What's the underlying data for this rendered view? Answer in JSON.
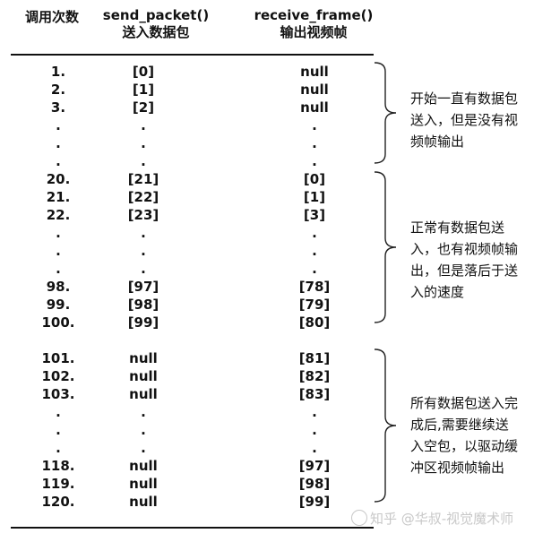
{
  "headers": {
    "call_count": "调用次数",
    "send_packet_line1": "send_packet()",
    "send_packet_line2": "送入数据包",
    "receive_frame_line1": "receive_frame()",
    "receive_frame_line2": "输出视频帧"
  },
  "rows": [
    {
      "n": "1.",
      "send": "[0]",
      "recv": "null"
    },
    {
      "n": "2.",
      "send": "[1]",
      "recv": "null"
    },
    {
      "n": "3.",
      "send": "[2]",
      "recv": "null"
    },
    {
      "n": ".",
      "send": ".",
      "recv": "."
    },
    {
      "n": ".",
      "send": ".",
      "recv": "."
    },
    {
      "n": ".",
      "send": ".",
      "recv": "."
    },
    {
      "n": "20.",
      "send": "[21]",
      "recv": "[0]"
    },
    {
      "n": "21.",
      "send": "[22]",
      "recv": "[1]"
    },
    {
      "n": "22.",
      "send": "[23]",
      "recv": "[3]"
    },
    {
      "n": ".",
      "send": ".",
      "recv": "."
    },
    {
      "n": ".",
      "send": ".",
      "recv": "."
    },
    {
      "n": ".",
      "send": ".",
      "recv": "."
    },
    {
      "n": "98.",
      "send": "[97]",
      "recv": "[78]"
    },
    {
      "n": "99.",
      "send": "[98]",
      "recv": "[79]"
    },
    {
      "n": "100.",
      "send": "[99]",
      "recv": "[80]"
    },
    {
      "n": "101.",
      "send": "null",
      "recv": "[81]"
    },
    {
      "n": "102.",
      "send": "null",
      "recv": "[82]"
    },
    {
      "n": "103.",
      "send": "null",
      "recv": "[83]"
    },
    {
      "n": ".",
      "send": ".",
      "recv": "."
    },
    {
      "n": ".",
      "send": ".",
      "recv": "."
    },
    {
      "n": ".",
      "send": ".",
      "recv": "."
    },
    {
      "n": "118.",
      "send": "null",
      "recv": "[97]"
    },
    {
      "n": "119.",
      "send": "null",
      "recv": "[98]"
    },
    {
      "n": "120.",
      "send": "null",
      "recv": "[99]"
    }
  ],
  "notes": [
    "开始一直有数据包送入，但是没有视频帧输出",
    "正常有数据包送入，也有视频帧输出，但是落后于送入的速度",
    "所有数据包送入完成后,需要继续送入空包，以驱动缓冲区视频帧输出"
  ],
  "watermark": "知乎 @华叔-视觉魔术师"
}
